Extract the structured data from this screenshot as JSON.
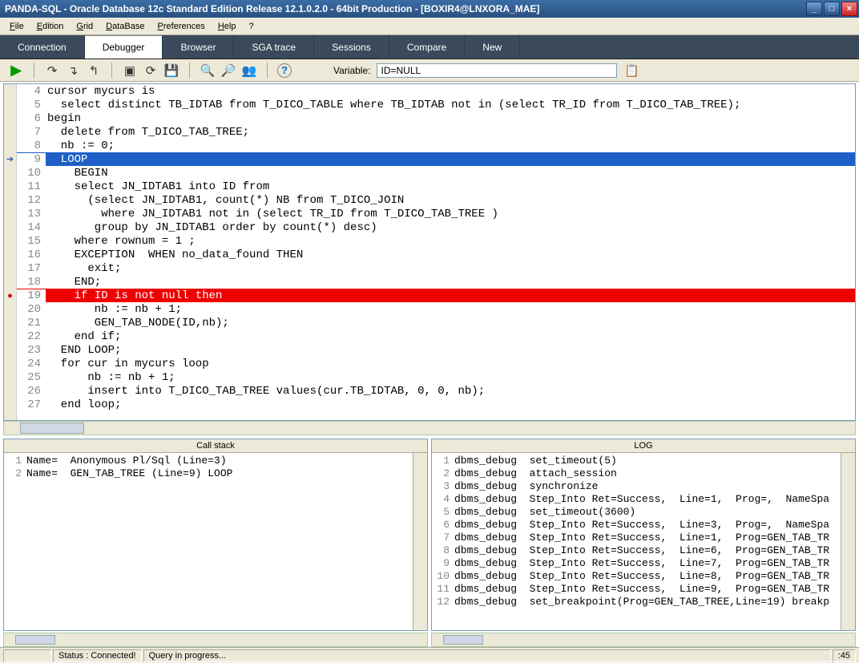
{
  "title": "PANDA-SQL - Oracle Database 12c Standard Edition Release 12.1.0.2.0 - 64bit Production - [BOXIR4@LNXORA_MAE]",
  "menu": [
    "File",
    "Edition",
    "Grid",
    "DataBase",
    "Preferences",
    "Help",
    "?"
  ],
  "tabs": [
    "Connection",
    "Debugger",
    "Browser",
    "SGA trace",
    "Sessions",
    "Compare",
    "New"
  ],
  "activeTab": "Debugger",
  "variable_label": "Variable:",
  "variable_value": "ID=NULL",
  "code": [
    {
      "n": 4,
      "t": "cursor mycurs is"
    },
    {
      "n": 5,
      "t": "  select distinct TB_IDTAB from T_DICO_TABLE where TB_IDTAB not in (select TR_ID from T_DICO_TAB_TREE);"
    },
    {
      "n": 6,
      "t": "begin"
    },
    {
      "n": 7,
      "t": "  delete from T_DICO_TAB_TREE;"
    },
    {
      "n": 8,
      "t": "  nb := 0;"
    },
    {
      "n": 9,
      "t": "  LOOP",
      "hl": "blue",
      "marker": "arrow"
    },
    {
      "n": 10,
      "t": "    BEGIN"
    },
    {
      "n": 11,
      "t": "    select JN_IDTAB1 into ID from"
    },
    {
      "n": 12,
      "t": "      (select JN_IDTAB1, count(*) NB from T_DICO_JOIN"
    },
    {
      "n": 13,
      "t": "        where JN_IDTAB1 not in (select TR_ID from T_DICO_TAB_TREE )"
    },
    {
      "n": 14,
      "t": "       group by JN_IDTAB1 order by count(*) desc)"
    },
    {
      "n": 15,
      "t": "    where rownum = 1 ;"
    },
    {
      "n": 16,
      "t": "    EXCEPTION  WHEN no_data_found THEN"
    },
    {
      "n": 17,
      "t": "      exit;"
    },
    {
      "n": 18,
      "t": "    END;"
    },
    {
      "n": 19,
      "t": "    if ID is not null then",
      "hl": "red",
      "marker": "breakpoint"
    },
    {
      "n": 20,
      "t": "       nb := nb + 1;"
    },
    {
      "n": 21,
      "t": "       GEN_TAB_NODE(ID,nb);"
    },
    {
      "n": 22,
      "t": "    end if;"
    },
    {
      "n": 23,
      "t": "  END LOOP;"
    },
    {
      "n": 24,
      "t": "  for cur in mycurs loop"
    },
    {
      "n": 25,
      "t": "      nb := nb + 1;"
    },
    {
      "n": 26,
      "t": "      insert into T_DICO_TAB_TREE values(cur.TB_IDTAB, 0, 0, nb);"
    },
    {
      "n": 27,
      "t": "  end loop;"
    }
  ],
  "callstack_title": "Call stack",
  "callstack": [
    {
      "n": 1,
      "t": "Name=  Anonymous Pl/Sql (Line=3)"
    },
    {
      "n": 2,
      "t": "Name=  GEN_TAB_TREE (Line=9) LOOP"
    }
  ],
  "log_title": "LOG",
  "log": [
    {
      "n": 1,
      "t": "dbms_debug  set_timeout(5)"
    },
    {
      "n": 2,
      "t": "dbms_debug  attach_session"
    },
    {
      "n": 3,
      "t": "dbms_debug  synchronize"
    },
    {
      "n": 4,
      "t": "dbms_debug  Step_Into Ret=Success,  Line=1,  Prog=,  NameSpa"
    },
    {
      "n": 5,
      "t": "dbms_debug  set_timeout(3600)"
    },
    {
      "n": 6,
      "t": "dbms_debug  Step_Into Ret=Success,  Line=3,  Prog=,  NameSpa"
    },
    {
      "n": 7,
      "t": "dbms_debug  Step_Into Ret=Success,  Line=1,  Prog=GEN_TAB_TR"
    },
    {
      "n": 8,
      "t": "dbms_debug  Step_Into Ret=Success,  Line=6,  Prog=GEN_TAB_TR"
    },
    {
      "n": 9,
      "t": "dbms_debug  Step_Into Ret=Success,  Line=7,  Prog=GEN_TAB_TR"
    },
    {
      "n": 10,
      "t": "dbms_debug  Step_Into Ret=Success,  Line=8,  Prog=GEN_TAB_TR"
    },
    {
      "n": 11,
      "t": "dbms_debug  Step_Into Ret=Success,  Line=9,  Prog=GEN_TAB_TR"
    },
    {
      "n": 12,
      "t": "dbms_debug  set_breakpoint(Prog=GEN_TAB_TREE,Line=19) breakp"
    }
  ],
  "status_connected": "Status : Connected!",
  "status_query": "Query in progress...",
  "status_time": ":45"
}
